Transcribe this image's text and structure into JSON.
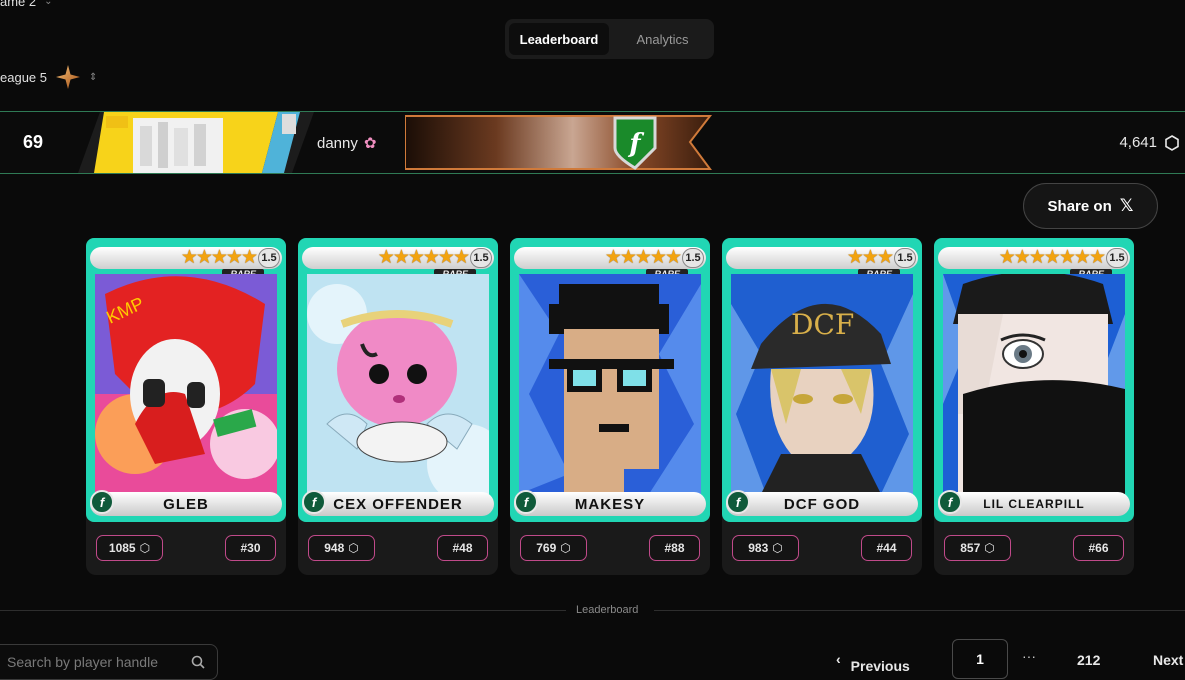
{
  "filters": {
    "game_label": "ame 2",
    "league_label": "eague 5"
  },
  "tabs": [
    {
      "label": "Leaderboard",
      "active": true
    },
    {
      "label": "Analytics",
      "active": false
    }
  ],
  "player": {
    "rank": "69",
    "name": "danny",
    "name_icon": "flower-icon",
    "score": "4,641",
    "score_icon": "hexagon-icon"
  },
  "share": {
    "label": "Share on",
    "icon": "x-logo-icon"
  },
  "cards": [
    {
      "name": "GLEB",
      "stars": "★★★★★",
      "level": "1.5",
      "rarity": "RARE",
      "points": "1085",
      "rank": "#30"
    },
    {
      "name": "CEX OFFENDER",
      "stars": "★★★★★★",
      "level": "1.5",
      "rarity": "RARE",
      "points": "948",
      "rank": "#48"
    },
    {
      "name": "MAKESY",
      "stars": "★★★★★",
      "level": "1.5",
      "rarity": "RARE",
      "points": "769",
      "rank": "#88"
    },
    {
      "name": "DCF GOD",
      "stars": "★★★",
      "level": "1.5",
      "rarity": "RARE",
      "points": "983",
      "rank": "#44"
    },
    {
      "name": "LIL CLEARPILL",
      "stars": "★★★★★★★",
      "level": "1.5",
      "rarity": "RARE",
      "points": "857",
      "rank": "#66"
    }
  ],
  "section_label": "Leaderboard",
  "search": {
    "placeholder": "Search by player handle"
  },
  "pagination": {
    "previous_label": "Previous",
    "current_page": "1",
    "ellipsis": "···",
    "last_page": "212",
    "next_label": "Next"
  },
  "colors": {
    "card_teal": "#21d6b4",
    "accent_green": "#2f7a55",
    "pill_border": "#c04a8a",
    "star_gold": "#f2a30f"
  }
}
